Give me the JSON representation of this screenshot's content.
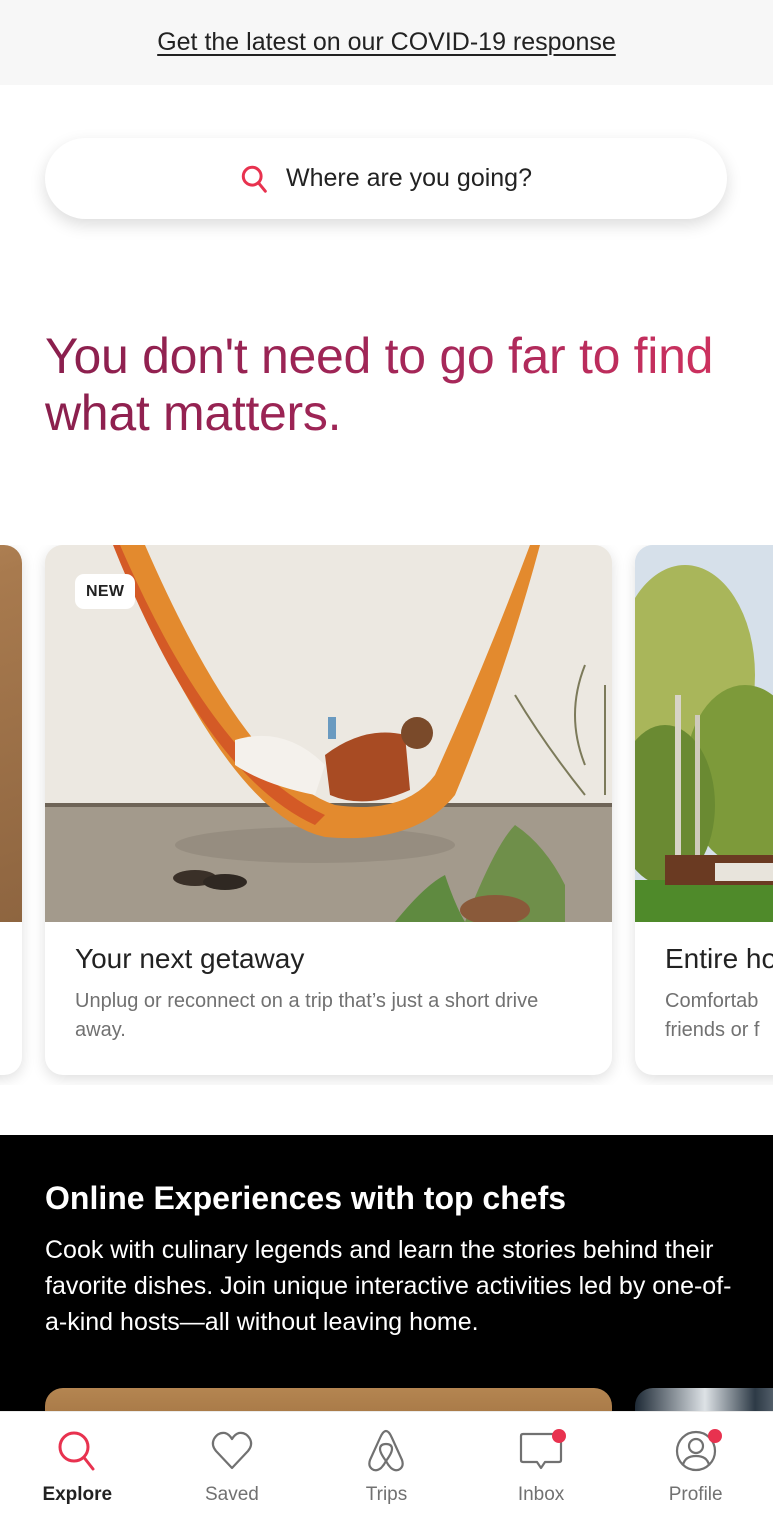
{
  "covid_banner": {
    "link_text": "Get the latest on our COVID-19 response"
  },
  "search": {
    "placeholder": "Where are you going?",
    "icon": "search-icon"
  },
  "hero": {
    "title": "You don't need to go far to find what matters."
  },
  "carousel": {
    "cards": [
      {
        "image": "wooden-surface-photo"
      },
      {
        "badge": "NEW",
        "title": "Your next getaway",
        "description": "Unplug or reconnect on a trip that’s just a short drive away.",
        "image": "hammock-photo"
      },
      {
        "title": "Entire ho",
        "description": "Comfortab friends or f",
        "image": "forest-house-photo"
      }
    ]
  },
  "online_experiences": {
    "title": "Online Experiences with top chefs",
    "description": "Cook with culinary legends and learn the stories behind their favorite dishes. Join unique interactive activities led by one-of-a-kind hosts—all without leaving home."
  },
  "tab_bar": {
    "tabs": [
      {
        "label": "Explore",
        "icon": "search-icon",
        "active": true,
        "notification": false
      },
      {
        "label": "Saved",
        "icon": "heart-icon",
        "active": false,
        "notification": false
      },
      {
        "label": "Trips",
        "icon": "airbnb-logo-icon",
        "active": false,
        "notification": false
      },
      {
        "label": "Inbox",
        "icon": "message-icon",
        "active": false,
        "notification": true
      },
      {
        "label": "Profile",
        "icon": "profile-icon",
        "active": false,
        "notification": true
      }
    ]
  },
  "colors": {
    "brand": "#e8324f",
    "hero_gradient_start": "#8a1f4d",
    "hero_gradient_end": "#d1325f",
    "text_primary": "#222222",
    "text_secondary": "#717171"
  }
}
